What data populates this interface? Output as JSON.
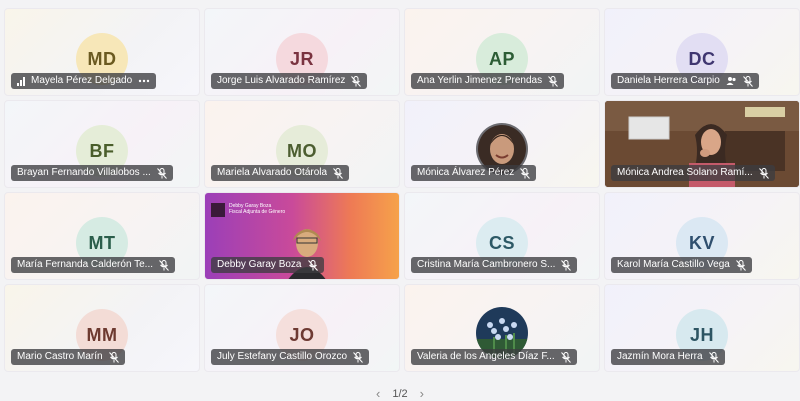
{
  "tiles": [
    {
      "initials": "MD",
      "name": "Mayela Pérez Delgado",
      "avatar_bg": "#f7e7b8",
      "avatar_fg": "#6b5a20",
      "tile": "t1",
      "lead_icon": "signal-icon",
      "trail_icon": "more-icon"
    },
    {
      "initials": "JR",
      "name": "Jorge Luis Alvarado Ramírez",
      "avatar_bg": "#f5d9de",
      "avatar_fg": "#7a3340",
      "tile": "t2",
      "trail_icon": "mic-muted-icon"
    },
    {
      "initials": "AP",
      "name": "Ana Yerlin Jimenez Prendas",
      "avatar_bg": "#d8ecdb",
      "avatar_fg": "#2c5d35",
      "tile": "t3",
      "trail_icon": "mic-muted-icon"
    },
    {
      "initials": "DC",
      "name": "Daniela Herrera Carpio",
      "avatar_bg": "#e2def3",
      "avatar_fg": "#3f3670",
      "tile": "t4",
      "extra_icon": "people-icon",
      "trail_icon": "mic-muted-icon"
    },
    {
      "initials": "BF",
      "name": "Brayan Fernando Villalobos ...",
      "avatar_bg": "#e5edd8",
      "avatar_fg": "#4a5e2b",
      "tile": "t2",
      "trail_icon": "mic-muted-icon"
    },
    {
      "initials": "MO",
      "name": "Mariela Alvarado Otárola",
      "avatar_bg": "#e6ecd9",
      "avatar_fg": "#4c5e30",
      "tile": "t3",
      "trail_icon": "mic-muted-icon"
    },
    {
      "photo": "woman",
      "name": "Mónica Álvarez Pérez",
      "tile": "t4",
      "trail_icon": "mic-muted-icon"
    },
    {
      "video": "office",
      "name": "Mónica Andrea Solano Ramí...",
      "trail_icon": "mic-muted-icon"
    },
    {
      "initials": "MT",
      "name": "María Fernanda Calderón Te...",
      "avatar_bg": "#d6ebe3",
      "avatar_fg": "#2b5e4b",
      "tile": "t3",
      "trail_icon": "mic-muted-icon"
    },
    {
      "video": "gradient",
      "name": "Debby Garay Boza",
      "banner_line1": "Debby Garay Boza",
      "banner_line2": "Fiscal Adjunta de Género",
      "trail_icon": "mic-muted-icon"
    },
    {
      "initials": "CS",
      "name": "Cristina María Cambronero S...",
      "avatar_bg": "#dcecf1",
      "avatar_fg": "#2d5966",
      "tile": "t2",
      "trail_icon": "mic-muted-icon"
    },
    {
      "initials": "KV",
      "name": "Karol María Castillo Vega",
      "avatar_bg": "#dbe8f3",
      "avatar_fg": "#2f4f6e",
      "tile": "t4",
      "trail_icon": "mic-muted-icon"
    },
    {
      "initials": "MM",
      "name": "Mario Castro Marín",
      "avatar_bg": "#f3dcd6",
      "avatar_fg": "#6d3a30",
      "tile": "t1",
      "trail_icon": "mic-muted-icon"
    },
    {
      "initials": "JO",
      "name": "July Estefany Castillo Orozco",
      "avatar_bg": "#f5dfdc",
      "avatar_fg": "#6e3a33",
      "tile": "t2",
      "trail_icon": "mic-muted-icon"
    },
    {
      "photo": "flowers",
      "name": "Valeria de los Angeles Díaz F...",
      "tile": "t3",
      "trail_icon": "mic-muted-icon"
    },
    {
      "initials": "JH",
      "name": "Jazmín Mora Herra",
      "avatar_bg": "#d7e9ef",
      "avatar_fg": "#2d5563",
      "tile": "t4",
      "trail_icon": "mic-muted-icon"
    }
  ],
  "pager": {
    "label": "1/2",
    "prev": "‹",
    "next": "›"
  }
}
